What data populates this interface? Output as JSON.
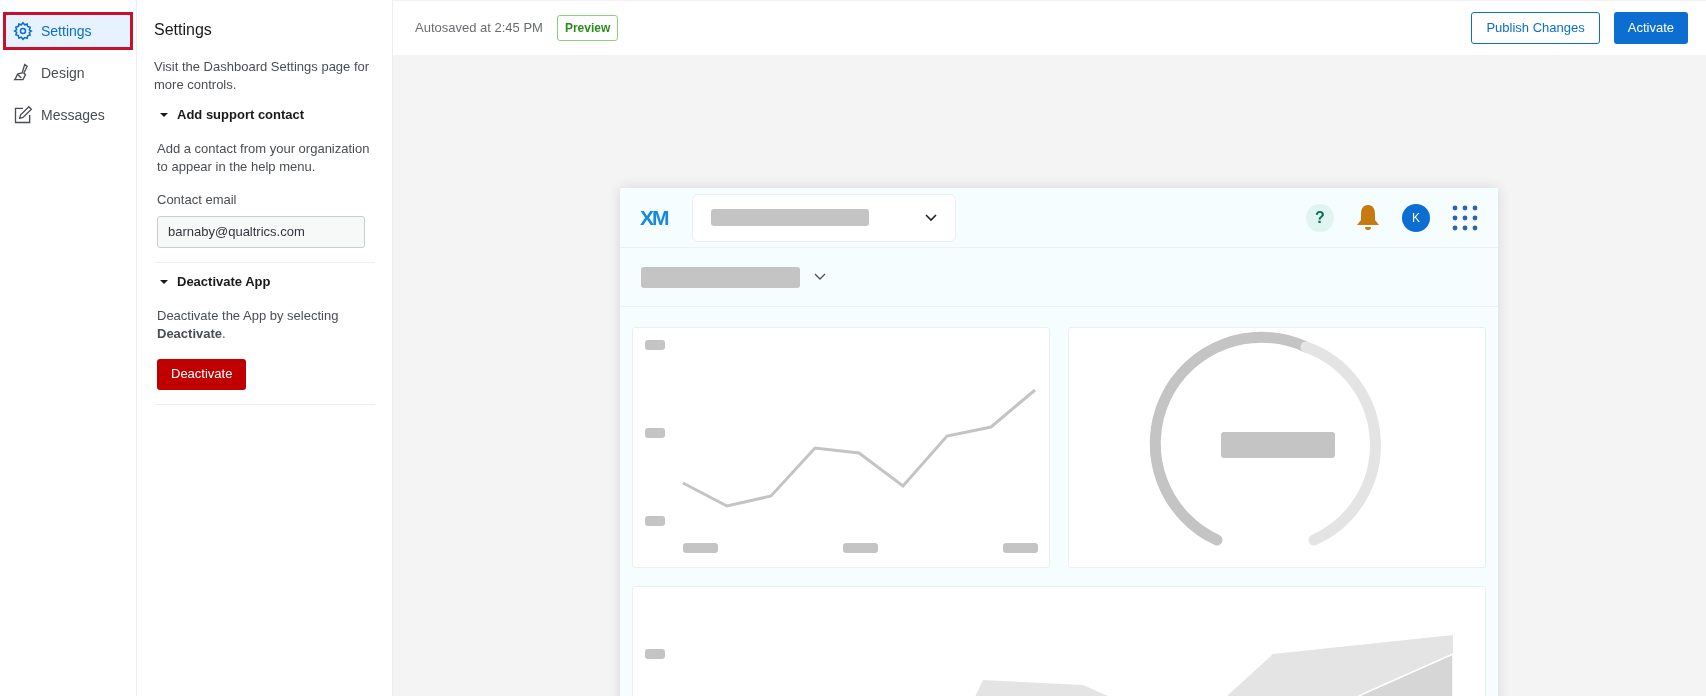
{
  "nav": {
    "items": [
      {
        "label": "Settings",
        "selected": true
      },
      {
        "label": "Design",
        "selected": false
      },
      {
        "label": "Messages",
        "selected": false
      }
    ]
  },
  "settings_panel": {
    "title": "Settings",
    "description": "Visit the Dashboard Settings page for more controls.",
    "sections": [
      {
        "title": "Add support contact",
        "expanded": true,
        "kind": "field",
        "text": "Add a contact from your organization to appear in the help menu.",
        "field_label": "Contact email",
        "value": "barnaby@qualtrics.com"
      },
      {
        "title": "Deactivate App",
        "expanded": true,
        "kind": "button",
        "text": "Deactivate the App by selecting **Deactivate**.",
        "button": "Deactivate"
      }
    ]
  },
  "top_bar": {
    "autosave": "Autosaved at 2:45 PM",
    "badge": "Preview",
    "buttons": [
      {
        "label": "Publish Changes",
        "kind": "secondary"
      },
      {
        "label": "Activate",
        "kind": "primary"
      }
    ]
  },
  "preview": {
    "logo": "XM",
    "help": "?",
    "avatar": "K"
  }
}
